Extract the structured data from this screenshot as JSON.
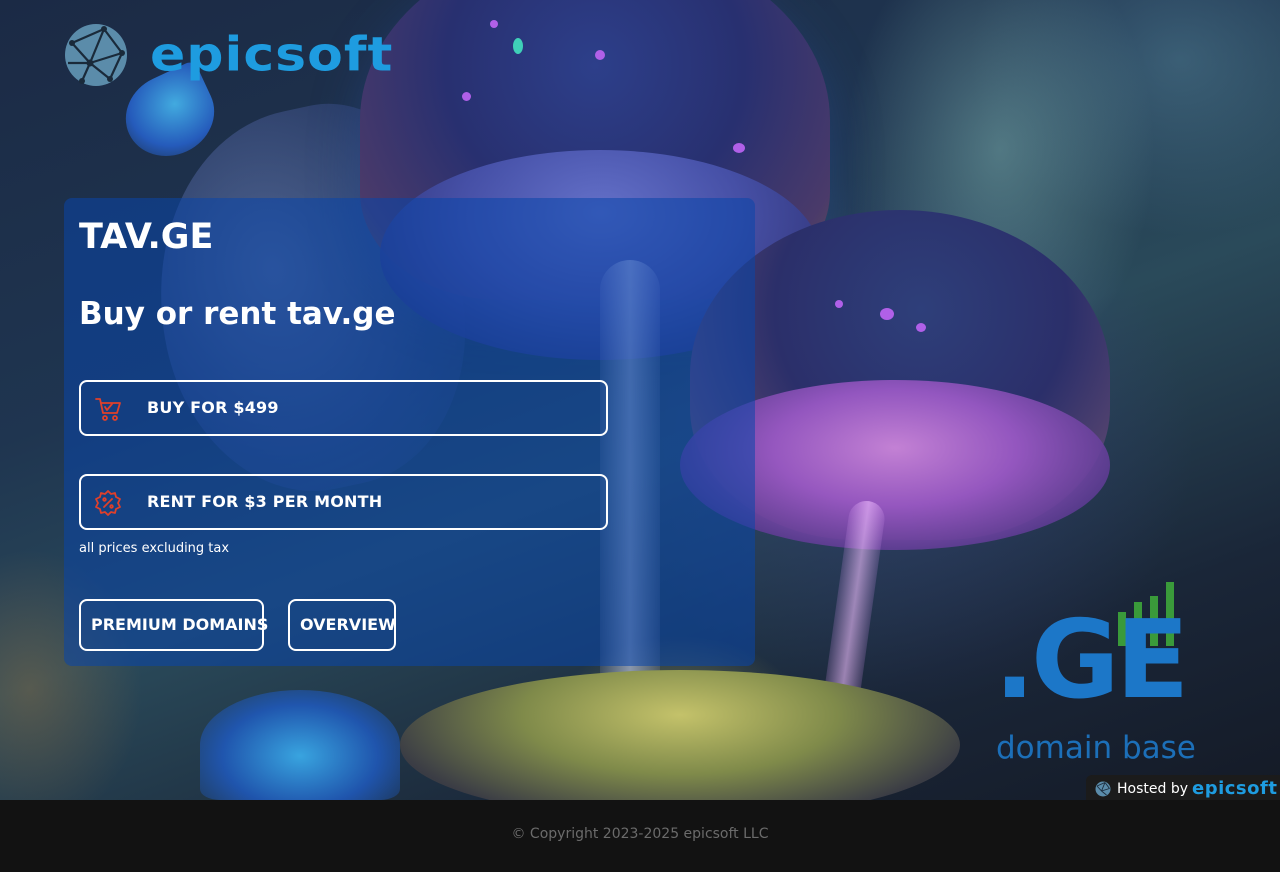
{
  "header": {
    "logo_text": "epicsoft",
    "logo_icon": "globe-network-icon"
  },
  "card": {
    "domain": "TAV.GE",
    "headline": "Buy or rent tav.ge",
    "buy_label": "BUY FOR $499",
    "buy_icon": "shopping-cart-icon",
    "rent_label": "RENT FOR $3 PER MONTH",
    "rent_icon": "discount-badge-icon",
    "tax_note": "all prices excluding tax",
    "premium_label": "PREMIUM DOMAINS",
    "overview_label": "OVERVIEW"
  },
  "brand_mark": {
    "letters": ".GE",
    "tagline": "domain base"
  },
  "hosted_badge": {
    "label": "Hosted by",
    "brand": "epicsoft"
  },
  "footer": {
    "copyright": "© Copyright 2023-2025 epicsoft LLC"
  },
  "colors": {
    "brand_blue": "#1e9ce0",
    "card_bg": "rgba(10,70,170,0.55)",
    "icon_red": "#e0402a",
    "ge_blue": "#1c77c8",
    "ge_green": "#3a9a3a"
  }
}
